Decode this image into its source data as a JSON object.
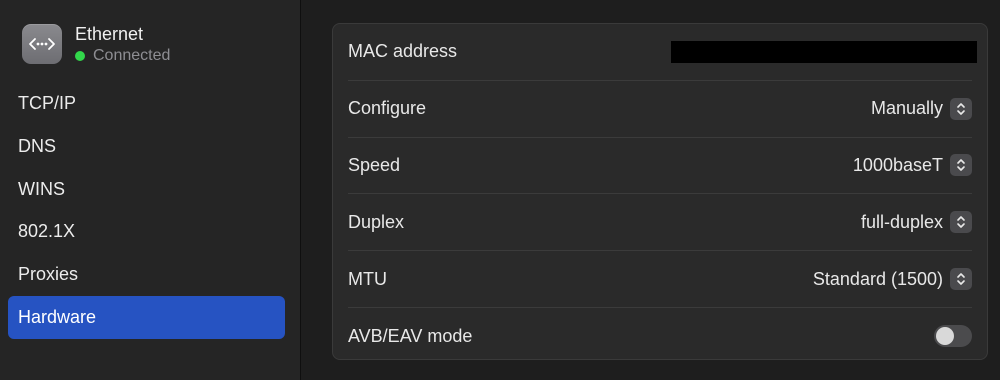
{
  "interface": {
    "name": "Ethernet",
    "status": "Connected",
    "status_color": "#32d74b",
    "icon": "ethernet-dots-icon"
  },
  "sidebar": {
    "items": [
      {
        "label": "TCP/IP",
        "selected": false
      },
      {
        "label": "DNS",
        "selected": false
      },
      {
        "label": "WINS",
        "selected": false
      },
      {
        "label": "802.1X",
        "selected": false
      },
      {
        "label": "Proxies",
        "selected": false
      },
      {
        "label": "Hardware",
        "selected": true
      }
    ],
    "selected_color": "#2653c2"
  },
  "hardware": {
    "mac_address": {
      "label": "MAC address",
      "value_redacted": true
    },
    "configure": {
      "label": "Configure",
      "value": "Manually"
    },
    "speed": {
      "label": "Speed",
      "value": "1000baseT"
    },
    "duplex": {
      "label": "Duplex",
      "value": "full-duplex"
    },
    "mtu": {
      "label": "MTU",
      "value": "Standard (1500)"
    },
    "avb": {
      "label": "AVB/EAV mode",
      "enabled": false
    }
  }
}
